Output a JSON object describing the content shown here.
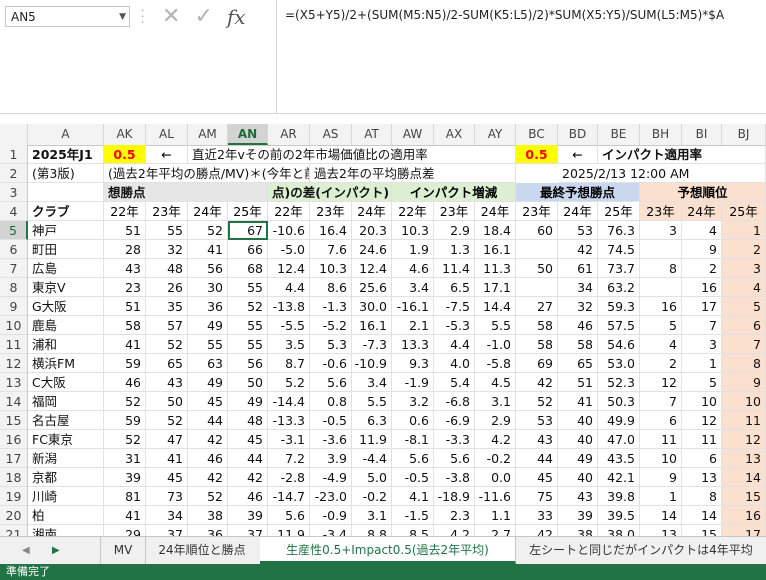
{
  "formula_bar": {
    "name_box": "AN5",
    "formula": "=(X5+Y5)/2+(SUM(M5:N5)/2-SUM(K5:L5)/2)*SUM(X5:Y5)/SUM(L5:M5)*$A"
  },
  "columns": [
    "A",
    "AK",
    "AL",
    "AM",
    "AN",
    "AR",
    "AS",
    "AT",
    "AW",
    "AX",
    "AY",
    "BC",
    "BD",
    "BE",
    "BH",
    "BI",
    "BJ"
  ],
  "selected_column": "AN",
  "row1": {
    "title": "2025年J1",
    "rate1": "0.5",
    "arrow1": "←",
    "desc1": "直近2年vその前の2年市場価値比の適用率",
    "rate2": "0.5",
    "arrow2": "←",
    "desc2": "インパクト適用率"
  },
  "row2": {
    "version": "(第3版)",
    "desc": "(過去2年平均の勝点/MV)＊(今年と前年のMV",
    "desc_b": "過去2年の平均勝点差",
    "datetime": "2025/2/13 12:00 AM"
  },
  "row3": {
    "h1": "想勝点",
    "h2": "点)の差(インパクト)",
    "h3": "インパクト増減",
    "h4": "最終予想勝点",
    "h5": "予想順位"
  },
  "row4": {
    "club": "クラブ",
    "years": [
      "22年",
      "23年",
      "24年",
      "25年",
      "22年",
      "23年",
      "24年",
      "22年",
      "23年",
      "24年",
      "23年",
      "24年",
      "25年",
      "23年",
      "24年",
      "25年"
    ]
  },
  "clubs": [
    {
      "row": "5",
      "name": "神戸",
      "v": [
        "51",
        "55",
        "52",
        "67",
        "-10.6",
        "16.4",
        "20.3",
        "10.3",
        "2.9",
        "18.4",
        "60",
        "53",
        "76.3",
        "3",
        "4",
        "1"
      ]
    },
    {
      "row": "6",
      "name": "町田",
      "v": [
        "28",
        "32",
        "41",
        "66",
        "-5.0",
        "7.6",
        "24.6",
        "1.9",
        "1.3",
        "16.1",
        "",
        "42",
        "74.5",
        "",
        "9",
        "2"
      ]
    },
    {
      "row": "7",
      "name": "広島",
      "v": [
        "43",
        "48",
        "56",
        "68",
        "12.4",
        "10.3",
        "12.4",
        "4.6",
        "11.4",
        "11.3",
        "50",
        "61",
        "73.7",
        "8",
        "2",
        "3"
      ]
    },
    {
      "row": "8",
      "name": "東京V",
      "v": [
        "23",
        "26",
        "30",
        "55",
        "4.4",
        "8.6",
        "25.6",
        "3.4",
        "6.5",
        "17.1",
        "",
        "34",
        "63.2",
        "",
        "16",
        "4"
      ]
    },
    {
      "row": "9",
      "name": "G大阪",
      "v": [
        "51",
        "35",
        "36",
        "52",
        "-13.8",
        "-1.3",
        "30.0",
        "-16.1",
        "-7.5",
        "14.4",
        "27",
        "32",
        "59.3",
        "16",
        "17",
        "5"
      ]
    },
    {
      "row": "10",
      "name": "鹿島",
      "v": [
        "58",
        "57",
        "49",
        "55",
        "-5.5",
        "-5.2",
        "16.1",
        "2.1",
        "-5.3",
        "5.5",
        "58",
        "46",
        "57.5",
        "5",
        "7",
        "6"
      ]
    },
    {
      "row": "11",
      "name": "浦和",
      "v": [
        "41",
        "52",
        "55",
        "55",
        "3.5",
        "5.3",
        "-7.3",
        "13.3",
        "4.4",
        "-1.0",
        "58",
        "58",
        "54.6",
        "4",
        "3",
        "7"
      ]
    },
    {
      "row": "12",
      "name": "横浜FM",
      "v": [
        "59",
        "65",
        "63",
        "56",
        "8.7",
        "-0.6",
        "-10.9",
        "9.3",
        "4.0",
        "-5.8",
        "69",
        "65",
        "53.0",
        "2",
        "1",
        "8"
      ]
    },
    {
      "row": "13",
      "name": "C大阪",
      "v": [
        "46",
        "43",
        "49",
        "50",
        "5.2",
        "5.6",
        "3.4",
        "-1.9",
        "5.4",
        "4.5",
        "42",
        "51",
        "52.3",
        "12",
        "5",
        "9"
      ]
    },
    {
      "row": "14",
      "name": "福岡",
      "v": [
        "52",
        "50",
        "45",
        "49",
        "-14.4",
        "0.8",
        "5.5",
        "3.2",
        "-6.8",
        "3.1",
        "52",
        "41",
        "50.3",
        "7",
        "10",
        "10"
      ]
    },
    {
      "row": "15",
      "name": "名古屋",
      "v": [
        "59",
        "52",
        "44",
        "48",
        "-13.3",
        "-0.5",
        "6.3",
        "0.6",
        "-6.9",
        "2.9",
        "53",
        "40",
        "49.9",
        "6",
        "12",
        "11"
      ]
    },
    {
      "row": "16",
      "name": "FC東京",
      "v": [
        "52",
        "47",
        "42",
        "45",
        "-3.1",
        "-3.6",
        "11.9",
        "-8.1",
        "-3.3",
        "4.2",
        "43",
        "40",
        "47.0",
        "11",
        "11",
        "12"
      ]
    },
    {
      "row": "17",
      "name": "新潟",
      "v": [
        "31",
        "41",
        "46",
        "44",
        "7.2",
        "3.9",
        "-4.4",
        "5.6",
        "5.6",
        "-0.2",
        "44",
        "49",
        "43.5",
        "10",
        "6",
        "13"
      ]
    },
    {
      "row": "18",
      "name": "京都",
      "v": [
        "39",
        "45",
        "42",
        "42",
        "-2.8",
        "-4.9",
        "5.0",
        "-0.5",
        "-3.8",
        "0.0",
        "45",
        "40",
        "42.1",
        "9",
        "13",
        "14"
      ]
    },
    {
      "row": "19",
      "name": "川崎",
      "v": [
        "81",
        "73",
        "52",
        "46",
        "-14.7",
        "-23.0",
        "-0.2",
        "4.1",
        "-18.9",
        "-11.6",
        "75",
        "43",
        "39.8",
        "1",
        "8",
        "15"
      ]
    },
    {
      "row": "20",
      "name": "柏",
      "v": [
        "41",
        "34",
        "38",
        "39",
        "5.6",
        "-0.9",
        "3.1",
        "-1.5",
        "2.3",
        "1.1",
        "33",
        "39",
        "39.5",
        "14",
        "14",
        "16"
      ]
    },
    {
      "row": "21",
      "name": "湘南",
      "v": [
        "29",
        "37",
        "36",
        "37",
        "11.9",
        "-3.4",
        "8.8",
        "8.5",
        "4.2",
        "2.7",
        "42",
        "38",
        "38.0",
        "13",
        "15",
        "17"
      ]
    }
  ],
  "sheet_tabs": [
    "MV",
    "24年順位と勝点",
    "生産性0.5+Impact0.5(過去2年平均)",
    "左シートと同じだがインパクトは4年平均"
  ],
  "active_tab_index": 2,
  "status_text": "準備完了",
  "colors": {
    "excel_green": "#217346",
    "header_green": "#dcefd2",
    "header_blue": "#c9d7ef",
    "header_peach": "#fbe0d0",
    "highlight_yellow": "#ffff00"
  }
}
